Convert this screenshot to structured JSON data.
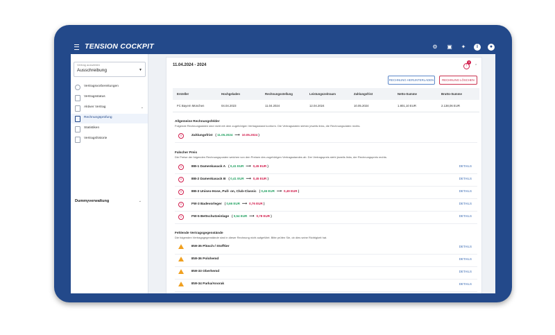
{
  "app": {
    "logo": "TENSION COCKPIT"
  },
  "topbar": {
    "icons": [
      "settings-icon",
      "calendar-icon",
      "tools-icon",
      "info-icon",
      "user-icon"
    ]
  },
  "sidebar": {
    "select": {
      "label": "Vertrag auswählen",
      "value": "Ausschreibung"
    },
    "items": [
      {
        "label": "Vertragsvorbereitungen"
      },
      {
        "label": "Vertragsstatus"
      },
      {
        "label": "Aktiver Vertrag"
      },
      {
        "label": "Rechnungsprüfung"
      },
      {
        "label": "Statistiken"
      },
      {
        "label": "Vertragshistorie"
      }
    ],
    "section": "Dummyverwaltung"
  },
  "main": {
    "title": "11.04.2024 - 2024",
    "warn_count": "3",
    "buttons": {
      "download": "RECHNUNG HERUNTERLADEN",
      "delete": "RECHNUNG LÖSCHEN"
    },
    "table": {
      "headers": [
        "Ersteller",
        "Hochgeladen",
        "Rechnungsstellung",
        "Leistungszeitraum",
        "Zahlungsfrist",
        "Netto-Summe",
        "Brutto-Summe"
      ],
      "row": [
        "FC Bayern München",
        "04.04.2023",
        "11.04.2024",
        "12.04.2024",
        "10.05.2024",
        "1.801,10 EUR",
        "2.138,06 EUR"
      ]
    },
    "general": {
      "title": "Allgemeine Rechnungsfelder",
      "desc": "Folgende Rechnungsdaten sind nicht mit dem zugehörigen Vertragsstand konform. Die Vertragsdaten stehen jeweils links, die Rechnungsdaten rechts.",
      "rows": [
        {
          "label": "Zahlungsfrist",
          "old": "11.05.2024",
          "new": "10.05.2024"
        }
      ]
    },
    "price": {
      "title": "Falscher Preis",
      "desc": "Die Preise der folgenden Rechnungsposten weichen von den Preisen des zugehörigen Vertragsstandes ab. Der Vertragspreis steht jeweils links, der Rechnungspreis rechts.",
      "details": "DETAILS",
      "rows": [
        {
          "label": "BB-1 Damenkasack A",
          "old": "0,41 EUR",
          "new": "0,45 EUR"
        },
        {
          "label": "BB-2 Damenkasack B",
          "old": "0,41 EUR",
          "new": "0,45 EUR"
        },
        {
          "label": "BB-3 Unisex-Hose, Pull- on, Club-Classic",
          "old": "0,46 EUR",
          "new": "0,49 EUR"
        },
        {
          "label": "FW-3 Badevorleger",
          "old": "0,66 EUR",
          "new": "0,76 EUR"
        },
        {
          "label": "FW-5 Bettschutzeinlage",
          "old": "0,54 EUR",
          "new": "0,78 EUR"
        }
      ]
    },
    "missing": {
      "title": "Fehlende Vertragsgegenstände",
      "desc": "Die folgenden Vertragsgegenstände sind in dieser Rechnung nicht aufgeführt. Bitte prüfen Sie, ob dies seine Richtigkeit hat.",
      "details": "DETAILS",
      "rows": [
        {
          "label": "BW-35 Plüsch-/ Stofftier"
        },
        {
          "label": "BW-36 Polohemd"
        },
        {
          "label": "BW-33 Oberhemd"
        },
        {
          "label": "BW-34 Parka/Anorak"
        }
      ]
    }
  }
}
